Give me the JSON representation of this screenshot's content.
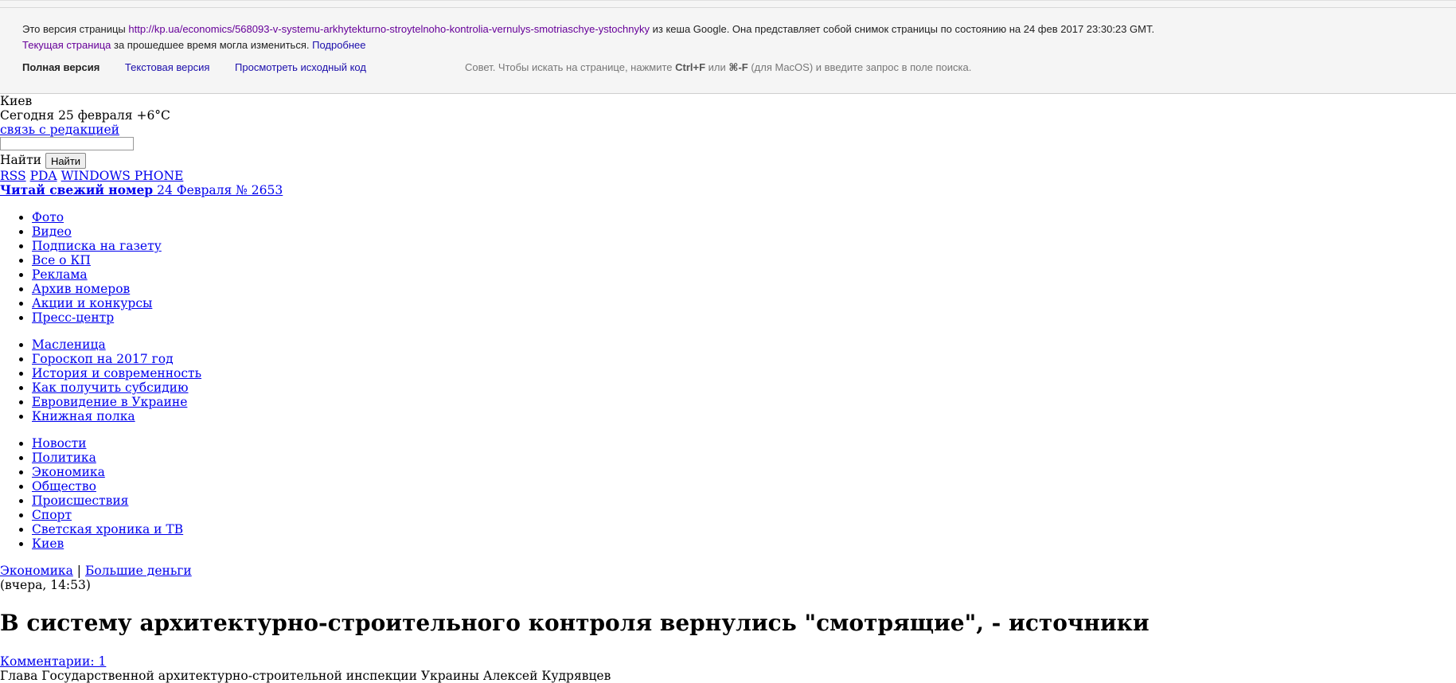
{
  "cache_banner": {
    "prefix": "Это версия страницы ",
    "cached_url": "http://kp.ua/economics/568093-v-systemu-arkhytekturno-stroytelnoho-kontrolia-vernulys-smotriaschye-ystochnyky",
    "suffix": " из кеша Google. Она представляет собой снимок страницы по состоянию на 24 фев 2017 23:30:23 GMT.",
    "current_page_link": "Текущая страница",
    "changed_text": " за прошедшее время могла измениться. ",
    "more_link": "Подробнее",
    "full_version": "Полная версия",
    "text_version": "Текстовая версия",
    "view_source": "Просмотреть исходный код",
    "tip_prefix": "Совет. Чтобы искать на странице, нажмите ",
    "tip_key1": "Ctrl+F",
    "tip_mid": " или ",
    "tip_key2": "⌘-F",
    "tip_suffix": " (для MacOS) и введите запрос в поле поиска."
  },
  "header": {
    "city": "Киев",
    "weather": "Сегодня 25 февраля +6°C",
    "contact_link": "связь с редакцией",
    "search_value": "",
    "search_label": "Найти",
    "search_button": "Найти",
    "platform_links": [
      "RSS",
      "PDA",
      "WINDOWS PHONE"
    ],
    "fresh_issue_bold": "Читай свежий номер",
    "fresh_issue_date": " 24 Февраля № 2653"
  },
  "nav_service": [
    "Фото",
    "Видео",
    "Подписка на газету",
    "Все о КП",
    "Реклама",
    "Архив номеров",
    "Акции и конкурсы",
    "Пресс-центр"
  ],
  "nav_special": [
    "Масленица",
    "Гороскоп на 2017 год",
    "История и современность",
    "Как получить субсидию",
    "Евровидение в Украине",
    "Книжная полка"
  ],
  "nav_sections": [
    "Новости",
    "Политика",
    "Экономика",
    "Общество",
    "Происшествия",
    "Спорт",
    "Светская хроника и ТВ",
    "Киев"
  ],
  "article": {
    "breadcrumb": [
      "Экономика",
      "Большие деньги"
    ],
    "breadcrumb_sep": " | ",
    "time": "(вчера, 14:53)",
    "title": "В систему архитектурно-строительного контроля вернулись \"смотрящие\", - источники",
    "comments_link": "Комментарии: 1",
    "photo_caption": "Глава Государственной архитектурно-строительной инспекции Украины Алексей Кудрявцев"
  }
}
